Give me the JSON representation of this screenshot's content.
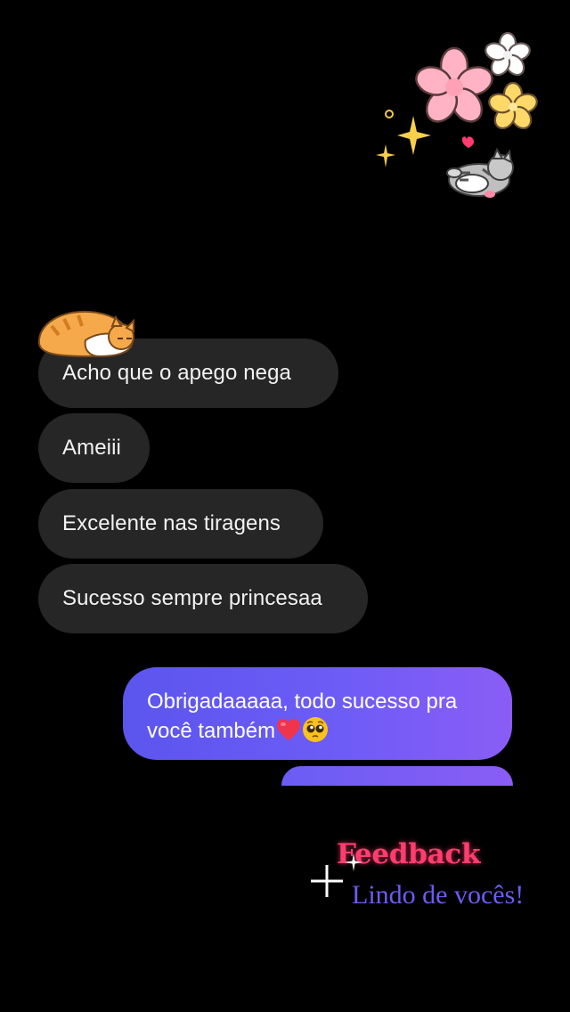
{
  "messages": {
    "received": [
      {
        "text": "Acho que o apego nega"
      },
      {
        "text": "Ameiii"
      },
      {
        "text": "Excelente nas tiragens"
      },
      {
        "text": "Sucesso sempre princesaa"
      }
    ],
    "sent": [
      {
        "text": "Obrigadaaaaa, todo sucesso pra",
        "text2": "você também",
        "emojis": [
          "red-heart-icon",
          "pleading-face-icon"
        ]
      }
    ]
  },
  "feedback": {
    "title": "Feedback",
    "subtitle": "Lindo de vocês!"
  },
  "colors": {
    "background": "#000000",
    "bubble_received": "#262626",
    "bubble_sent_start": "#5b55ee",
    "bubble_sent_end": "#8a5df5",
    "feedback_title": "#ff3d6e",
    "feedback_subtitle": "#6c5cf2"
  }
}
